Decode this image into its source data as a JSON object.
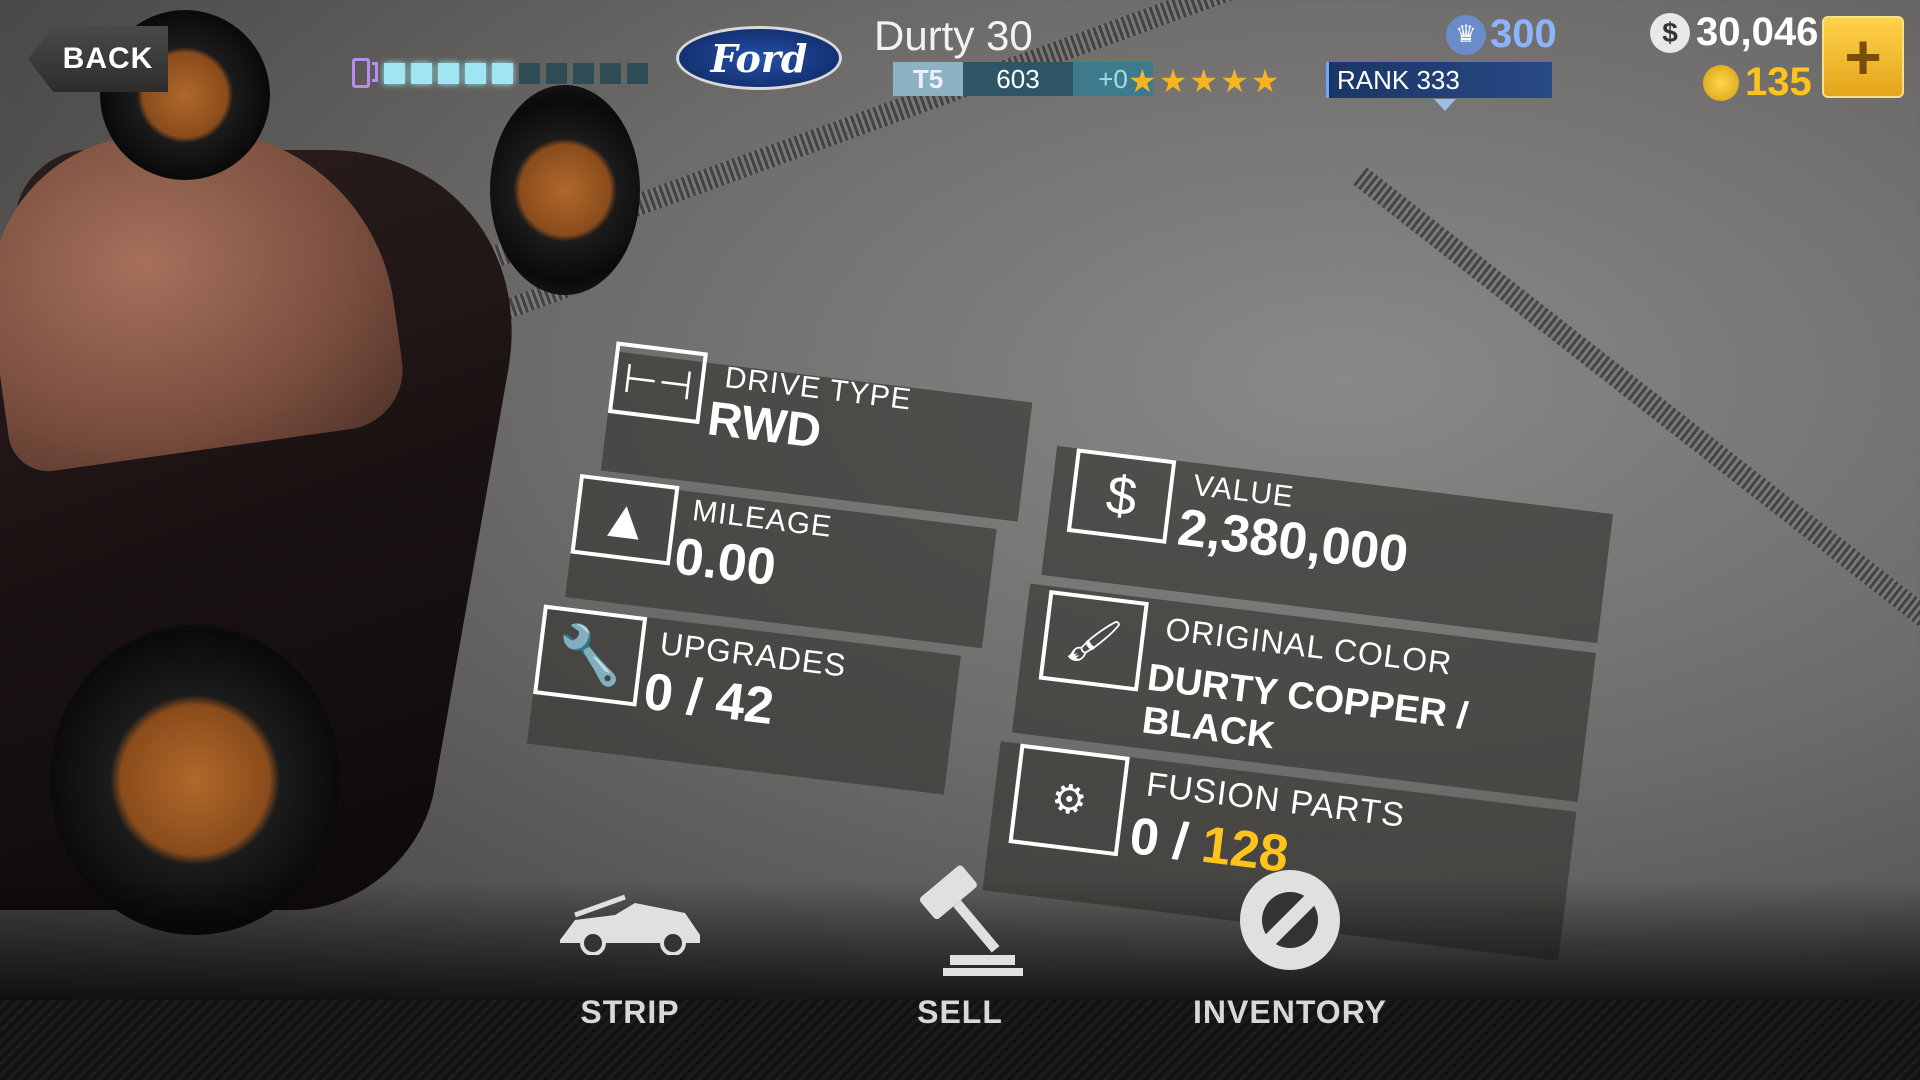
{
  "header": {
    "back_label": "BACK",
    "fuel": {
      "filled": 5,
      "total": 10,
      "icon": "fuel-pump-icon"
    },
    "brand": "Ford",
    "car_name": "Durty 30",
    "tier": "T5",
    "pp": "603",
    "pp_bonus": "+0",
    "stars": "★★★★★",
    "rank_label": "RANK 333"
  },
  "currency": {
    "crowns": "300",
    "cash": "30,046",
    "gold": "135",
    "add_label": "+"
  },
  "stats": {
    "drive_type": {
      "label": "DRIVE TYPE",
      "value": "RWD"
    },
    "mileage": {
      "label": "MILEAGE",
      "value": "0.00"
    },
    "upgrades": {
      "label": "UPGRADES",
      "value": "0 / 42"
    },
    "value": {
      "label": "VALUE",
      "value": "2,380,000"
    },
    "original_color": {
      "label": "ORIGINAL COLOR",
      "value": "DURTY COPPER / BLACK"
    },
    "fusion_parts": {
      "label": "FUSION PARTS",
      "owned": "0 / ",
      "total": "128"
    }
  },
  "actions": [
    {
      "label": "STRIP",
      "icon": "car-hood-icon"
    },
    {
      "label": "SELL",
      "icon": "gavel-icon"
    },
    {
      "label": "INVENTORY",
      "icon": "wrench-circle-icon"
    }
  ],
  "colors": {
    "accent_gold": "#ffc41c",
    "crown_blue": "#8bb4ff",
    "fuel_on": "#9fe6f2",
    "star": "#f7b421"
  }
}
